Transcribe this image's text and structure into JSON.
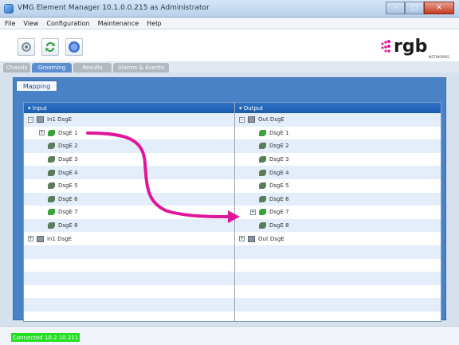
{
  "window": {
    "title": "VMG Element Manager 10.1.0.0.215 as Administrator",
    "controls": [
      "–",
      "□",
      "✕"
    ]
  },
  "menu": [
    "File",
    "View",
    "Configuration",
    "Maintenance",
    "Help"
  ],
  "toolbar": {
    "tools": [
      {
        "name": "settings-gear-icon",
        "color": "#6b7a8a"
      },
      {
        "name": "refresh-icon",
        "color": "#2aa33a"
      },
      {
        "name": "help-icon",
        "color": "#3f6fd0"
      }
    ]
  },
  "logo": {
    "brand": "rgb",
    "sub": "NETWORKS",
    "accent": "#e0169a"
  },
  "tabs": [
    {
      "label": "Chassis",
      "active": false
    },
    {
      "label": "Grooming",
      "active": true
    },
    {
      "label": "Results",
      "active": false
    },
    {
      "label": "Alarms & Events",
      "active": false
    }
  ],
  "subtab": {
    "label": "Mapping"
  },
  "left": {
    "header": "Input",
    "rows": [
      {
        "label": "In1 DsgE",
        "type": "device",
        "expander": "−",
        "level": 0
      },
      {
        "label": "DsgE 1",
        "type": "node",
        "expander": "+",
        "level": 1,
        "color": "#3aa23a"
      },
      {
        "label": "DsgE 2",
        "type": "node",
        "expander": "",
        "level": 1,
        "color": "#5a7c5a"
      },
      {
        "label": "DsgE 3",
        "type": "node",
        "expander": "",
        "level": 1,
        "color": "#5a7c5a"
      },
      {
        "label": "DsgE 4",
        "type": "node",
        "expander": "",
        "level": 1,
        "color": "#5a7c5a"
      },
      {
        "label": "DsgE 5",
        "type": "node",
        "expander": "",
        "level": 1,
        "color": "#5a7c5a"
      },
      {
        "label": "DsgE 6",
        "type": "node",
        "expander": "",
        "level": 1,
        "color": "#5a7c5a"
      },
      {
        "label": "DsgE 7",
        "type": "node",
        "expander": "",
        "level": 1,
        "color": "#3aa23a"
      },
      {
        "label": "DsgE 8",
        "type": "node",
        "expander": "",
        "level": 1,
        "color": "#5a7c5a"
      },
      {
        "label": "In1 DsgE",
        "type": "device",
        "expander": "+",
        "level": 0
      },
      {
        "label": "",
        "type": "empty"
      },
      {
        "label": "",
        "type": "empty"
      },
      {
        "label": "",
        "type": "empty"
      },
      {
        "label": "",
        "type": "empty"
      },
      {
        "label": "",
        "type": "empty"
      }
    ]
  },
  "right": {
    "header": "Output",
    "rows": [
      {
        "label": "Out DsgE",
        "type": "device",
        "expander": "−",
        "level": 0
      },
      {
        "label": "DsgE 1",
        "type": "node",
        "expander": "",
        "level": 1,
        "color": "#3aa23a"
      },
      {
        "label": "DsgE 2",
        "type": "node",
        "expander": "",
        "level": 1,
        "color": "#5a7c5a"
      },
      {
        "label": "DsgE 3",
        "type": "node",
        "expander": "",
        "level": 1,
        "color": "#5a7c5a"
      },
      {
        "label": "DsgE 4",
        "type": "node",
        "expander": "",
        "level": 1,
        "color": "#5a7c5a"
      },
      {
        "label": "DsgE 5",
        "type": "node",
        "expander": "",
        "level": 1,
        "color": "#5a7c5a"
      },
      {
        "label": "DsgE 6",
        "type": "node",
        "expander": "",
        "level": 1,
        "color": "#5a7c5a"
      },
      {
        "label": "DsgE 7",
        "type": "node",
        "expander": "+",
        "level": 1,
        "color": "#3aa23a"
      },
      {
        "label": "DsgE 8",
        "type": "node",
        "expander": "",
        "level": 1,
        "color": "#5a7c5a"
      },
      {
        "label": "Out DsgE",
        "type": "device",
        "expander": "+",
        "level": 0
      },
      {
        "label": "",
        "type": "empty"
      },
      {
        "label": "",
        "type": "empty"
      },
      {
        "label": "",
        "type": "empty"
      },
      {
        "label": "",
        "type": "empty"
      },
      {
        "label": "",
        "type": "empty"
      }
    ]
  },
  "annotation": {
    "color": "#e0169a"
  },
  "status": {
    "text": "Connected 10.2.10.211",
    "color": "#20e020"
  }
}
